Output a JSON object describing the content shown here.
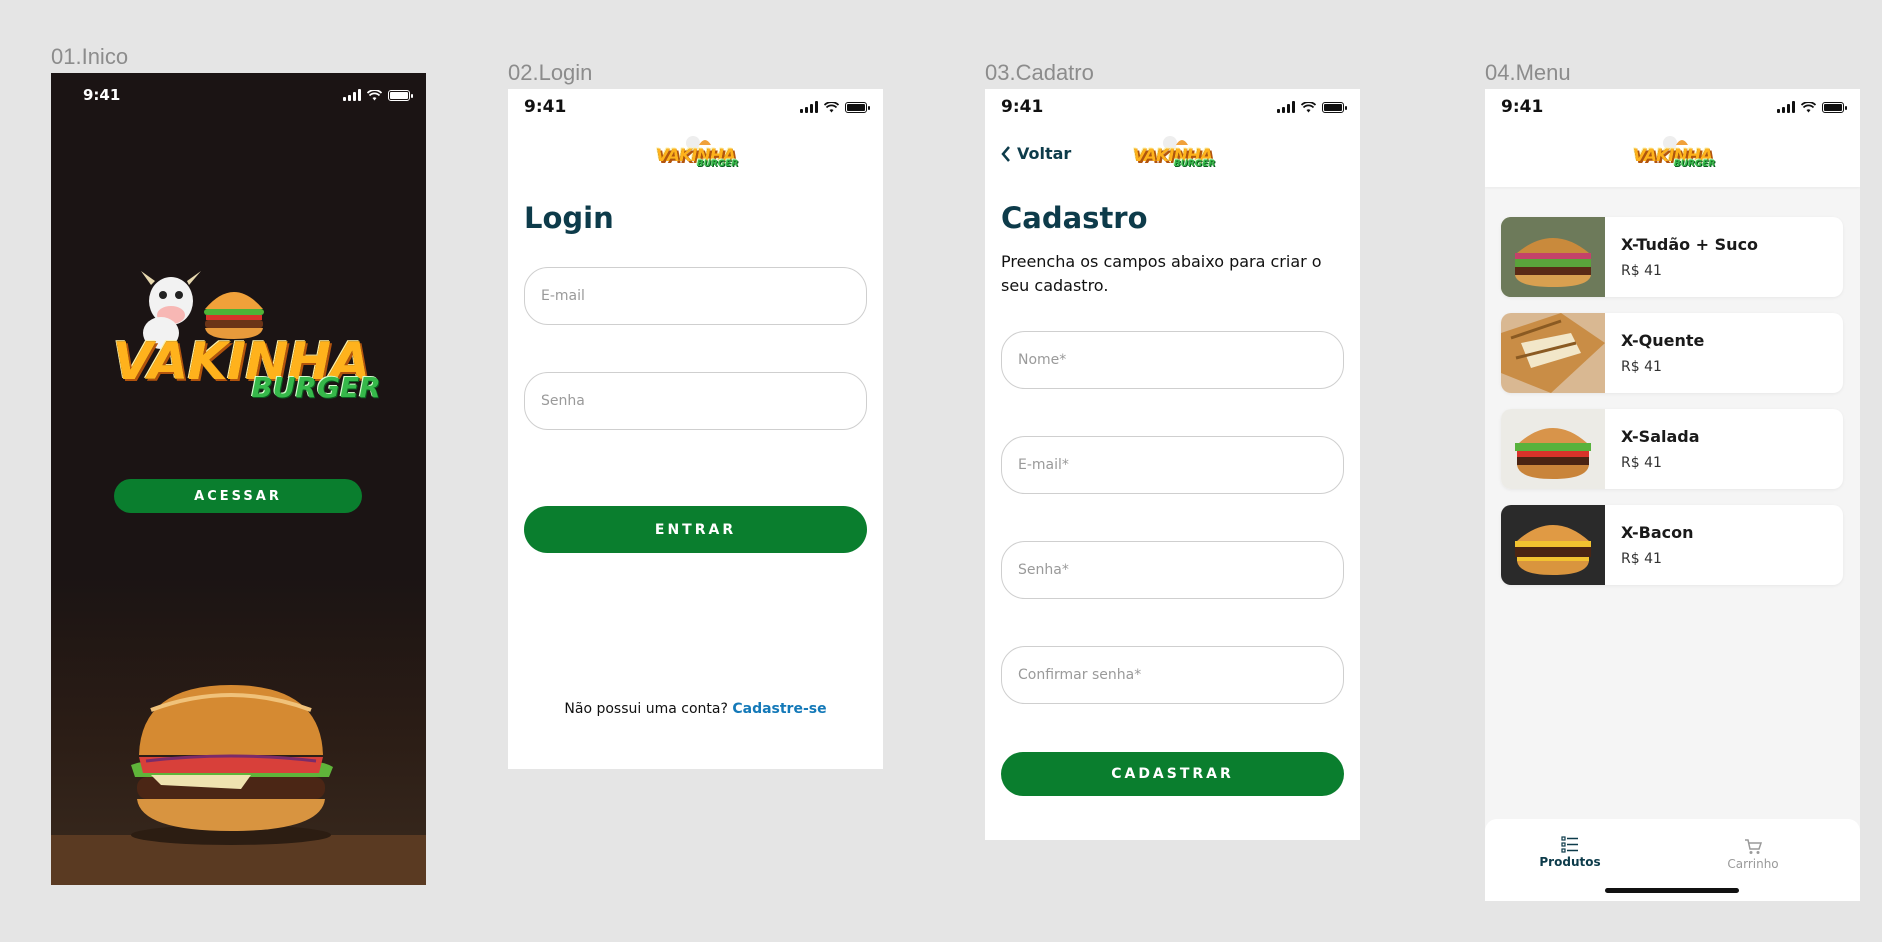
{
  "frames": [
    {
      "label": "01.Inico"
    },
    {
      "label": "02.Login"
    },
    {
      "label": "03.Cadatro"
    },
    {
      "label": "04.Menu"
    }
  ],
  "status_time": "9:41",
  "brand": {
    "word1": "VAKINHA",
    "word2": "BURGER"
  },
  "splash": {
    "button": "ACESSAR"
  },
  "login": {
    "title": "Login",
    "email_placeholder": "E-mail",
    "password_placeholder": "Senha",
    "submit": "ENTRAR",
    "signup_prompt": "Não possui uma conta?",
    "signup_link": "Cadastre-se"
  },
  "register": {
    "back": "Voltar",
    "title": "Cadastro",
    "subtitle_line1": "Preencha os campos abaixo para criar o",
    "subtitle_line2": "seu cadastro.",
    "name_placeholder": "Nome*",
    "email_placeholder": "E-mail*",
    "password_placeholder": "Senha*",
    "confirm_placeholder": "Confirmar senha*",
    "submit": "CADASTRAR"
  },
  "menu": {
    "products": [
      {
        "name": "X-Tudão + Suco",
        "price": "R$ 41"
      },
      {
        "name": "X-Quente",
        "price": "R$ 41"
      },
      {
        "name": "X-Salada",
        "price": "R$ 41"
      },
      {
        "name": "X-Bacon",
        "price": "R$ 41"
      }
    ],
    "tabs": [
      {
        "label": "Produtos",
        "icon": "list-icon"
      },
      {
        "label": "Carrinho",
        "icon": "cart-icon"
      }
    ]
  },
  "colors": {
    "primary_green": "#0a7e2e",
    "heading": "#0d3b4a",
    "link": "#1479b8",
    "splash_bg": "#1b1414"
  }
}
